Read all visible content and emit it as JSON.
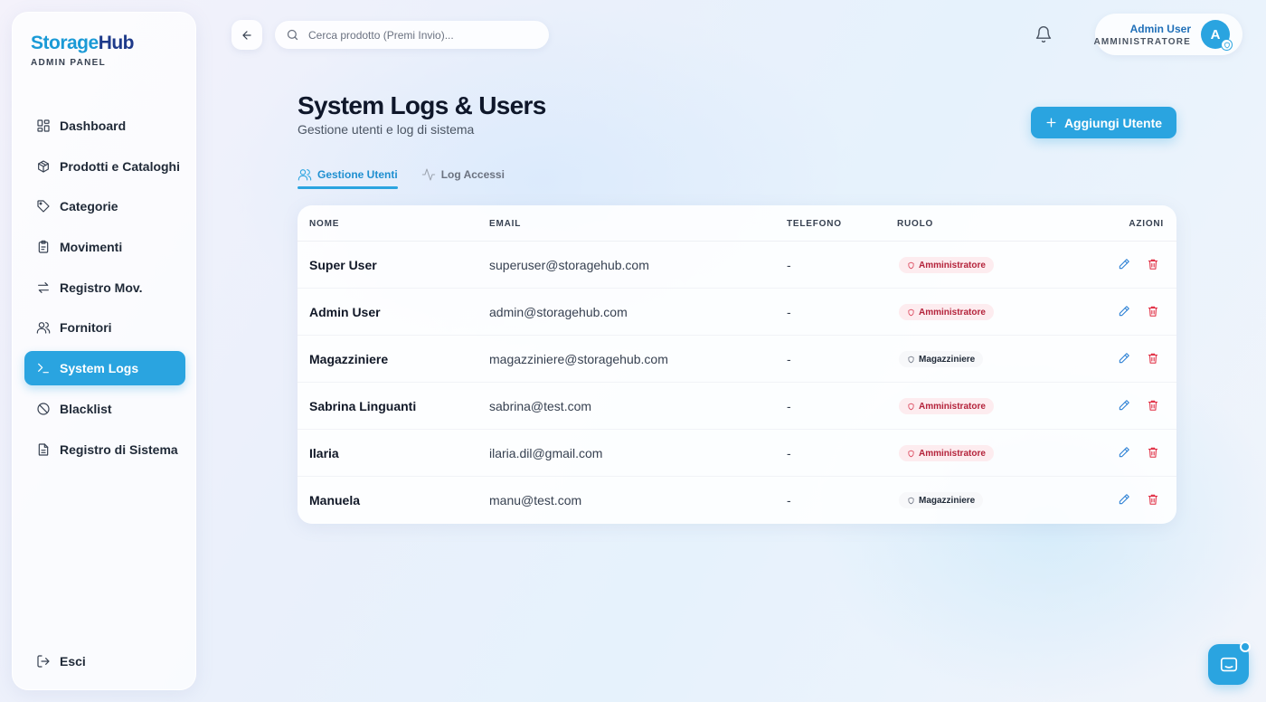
{
  "brand": {
    "name_part1": "Storage",
    "name_part2": "Hub",
    "subtitle": "ADMIN PANEL",
    "color_primary": "#1a9ad6",
    "color_secondary": "#1e3a8a"
  },
  "sidebar": {
    "items": [
      {
        "label": "Dashboard",
        "icon": "dashboard-icon",
        "active": false
      },
      {
        "label": "Prodotti e Cataloghi",
        "icon": "package-icon",
        "active": false
      },
      {
        "label": "Categorie",
        "icon": "tag-icon",
        "active": false
      },
      {
        "label": "Movimenti",
        "icon": "clipboard-icon",
        "active": false
      },
      {
        "label": "Registro Mov.",
        "icon": "arrows-swap-icon",
        "active": false
      },
      {
        "label": "Fornitori",
        "icon": "users-icon",
        "active": false
      },
      {
        "label": "System Logs",
        "icon": "terminal-icon",
        "active": true
      },
      {
        "label": "Blacklist",
        "icon": "ban-icon",
        "active": false
      },
      {
        "label": "Registro di Sistema",
        "icon": "file-text-icon",
        "active": false
      }
    ],
    "logout_label": "Esci"
  },
  "topbar": {
    "search_placeholder": "Cerca prodotto (Premi Invio)...",
    "user_name": "Admin User",
    "user_role": "AMMINISTRATORE",
    "avatar_initial": "A"
  },
  "page": {
    "title": "System Logs & Users",
    "subtitle": "Gestione utenti e log di sistema",
    "add_button_label": "Aggiungi Utente"
  },
  "tabs": [
    {
      "label": "Gestione Utenti",
      "icon": "users-icon",
      "active": true
    },
    {
      "label": "Log Accessi",
      "icon": "activity-icon",
      "active": false
    }
  ],
  "table": {
    "columns": {
      "name": "NOME",
      "email": "EMAIL",
      "phone": "TELEFONO",
      "role": "RUOLO",
      "actions": "AZIONI"
    },
    "rows": [
      {
        "name": "Super User",
        "email": "superuser@storagehub.com",
        "phone": "-",
        "role": "Amministratore",
        "role_type": "admin"
      },
      {
        "name": "Admin User",
        "email": "admin@storagehub.com",
        "phone": "-",
        "role": "Amministratore",
        "role_type": "admin"
      },
      {
        "name": "Magazziniere",
        "email": "magazziniere@storagehub.com",
        "phone": "-",
        "role": "Magazziniere",
        "role_type": "mag"
      },
      {
        "name": "Sabrina Linguanti",
        "email": "sabrina@test.com",
        "phone": "-",
        "role": "Amministratore",
        "role_type": "admin"
      },
      {
        "name": "Ilaria",
        "email": "ilaria.dil@gmail.com",
        "phone": "-",
        "role": "Amministratore",
        "role_type": "admin"
      },
      {
        "name": "Manuela",
        "email": "manu@test.com",
        "phone": "-",
        "role": "Magazziniere",
        "role_type": "mag"
      }
    ]
  },
  "colors": {
    "accent": "#2aa4e0",
    "danger": "#e0293f",
    "edit": "#2a7fd4"
  }
}
